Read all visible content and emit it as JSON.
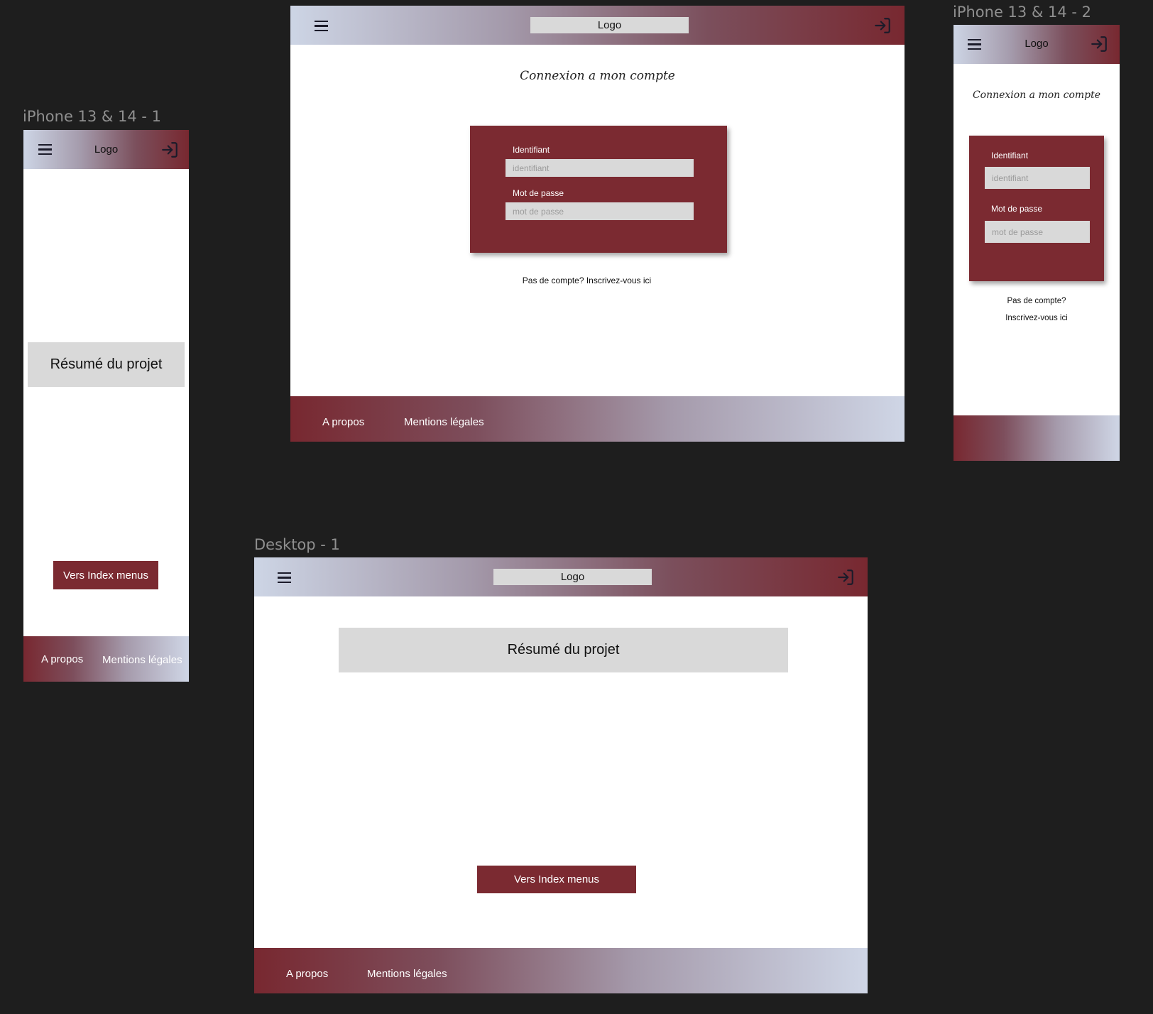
{
  "frames": {
    "iphone1": {
      "title": "iPhone 13 & 14 - 1"
    },
    "iphone2": {
      "title": "iPhone 13 & 14 - 2"
    },
    "desktop1": {
      "title": "Desktop - 1"
    }
  },
  "header": {
    "logo": "Logo",
    "menu_icon": "hamburger-menu-icon",
    "login_icon": "login-icon"
  },
  "home": {
    "resume": "Résumé du projet",
    "cta": "Vers Index menus"
  },
  "login": {
    "title": "Connexion a mon compte",
    "identifiant_label": "Identifiant",
    "identifiant_placeholder": "identifiant",
    "password_label": "Mot de passe",
    "password_placeholder": "mot de passe",
    "signup": "Pas de compte? Inscrivez-vous ici",
    "signup_line1": "Pas de compte?",
    "signup_line2": "Inscrivez-vous ici"
  },
  "footer": {
    "about": "A propos",
    "legal": "Mentions légales"
  },
  "colors": {
    "accent": "#7b2a31",
    "background": "#1e1e1e",
    "field": "#d9d9d9"
  }
}
